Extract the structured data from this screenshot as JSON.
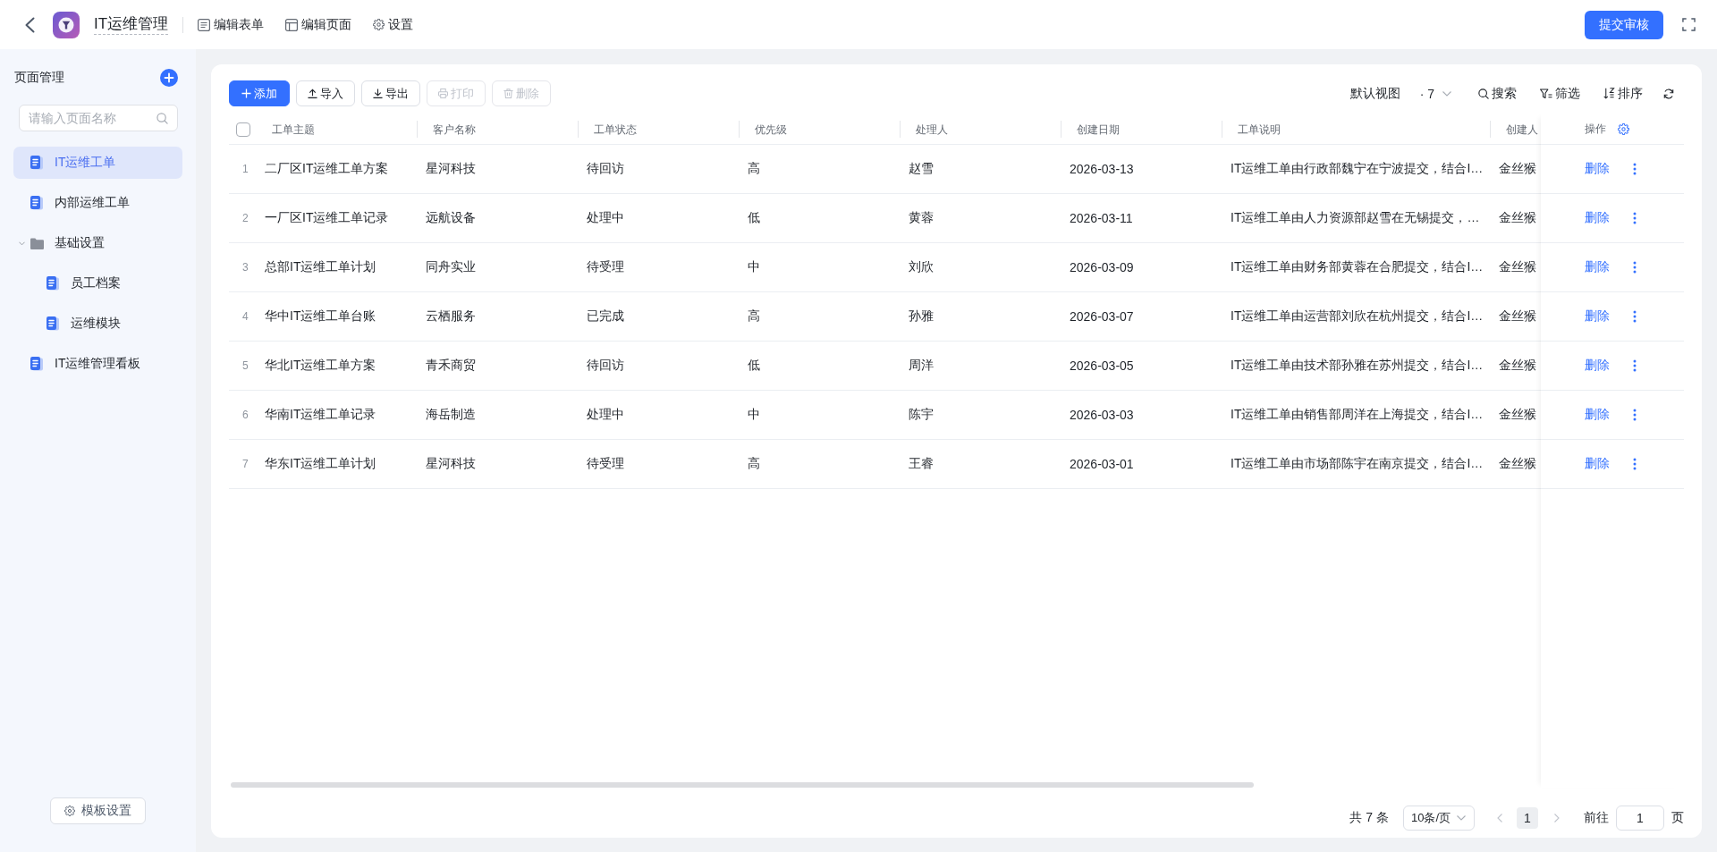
{
  "top_bar": {
    "title": "IT运维管理",
    "nav": [
      {
        "label": "编辑表单",
        "kind": "form"
      },
      {
        "label": "编辑页面",
        "kind": "layout"
      },
      {
        "label": "设置",
        "kind": "settings"
      }
    ],
    "submit_button": "提交审核"
  },
  "sidebar": {
    "title": "页面管理",
    "search": {
      "placeholder": "请输入页面名称"
    },
    "items": [
      {
        "label": "IT运维工单",
        "kind": "page",
        "selected": true
      },
      {
        "label": "内部运维工单",
        "kind": "page",
        "selected": false
      },
      {
        "label": "基础设置",
        "kind": "folder",
        "selected": false,
        "expanded": true,
        "children": [
          {
            "label": "员工档案",
            "kind": "page",
            "selected": false
          },
          {
            "label": "运维模块",
            "kind": "page",
            "selected": false
          }
        ]
      },
      {
        "label": "IT运维管理看板",
        "kind": "page",
        "selected": false
      }
    ],
    "footer_button": "模板设置"
  },
  "toolbar": {
    "buttons": [
      {
        "label": "添加",
        "kind": "add",
        "primary": true,
        "disabled": false
      },
      {
        "label": "导入",
        "kind": "import",
        "primary": false,
        "disabled": false
      },
      {
        "label": "导出",
        "kind": "export",
        "primary": false,
        "disabled": false
      },
      {
        "label": "打印",
        "kind": "print",
        "primary": false,
        "disabled": true
      },
      {
        "label": "删除",
        "kind": "delete",
        "primary": false,
        "disabled": true
      }
    ],
    "view": "默认视图",
    "view_count": "· 7",
    "tools": [
      {
        "label": "搜索",
        "kind": "search"
      },
      {
        "label": "筛选",
        "kind": "filter"
      },
      {
        "label": "排序",
        "kind": "sort"
      }
    ]
  },
  "table": {
    "select_all": {
      "checked": false
    },
    "columns": [
      "工单主题",
      "客户名称",
      "工单状态",
      "优先级",
      "处理人",
      "创建日期",
      "工单说明",
      "创建人"
    ],
    "action_column": "操作",
    "rows": [
      {
        "number": "1",
        "cells": [
          "二厂区IT运维工单方案",
          "星河科技",
          "待回访",
          "高",
          "赵雪",
          "2026-03-13",
          "IT运维工单由行政部魏宁在宁波提交，结合I…",
          "金丝猴"
        ],
        "action": "删除"
      },
      {
        "number": "2",
        "cells": [
          "一厂区IT运维工单记录",
          "远航设备",
          "处理中",
          "低",
          "黄蓉",
          "2026-03-11",
          "IT运维工单由人力资源部赵雪在无锡提交，…",
          "金丝猴"
        ],
        "action": "删除"
      },
      {
        "number": "3",
        "cells": [
          "总部IT运维工单计划",
          "同舟实业",
          "待受理",
          "中",
          "刘欣",
          "2026-03-09",
          "IT运维工单由财务部黄蓉在合肥提交，结合I…",
          "金丝猴"
        ],
        "action": "删除"
      },
      {
        "number": "4",
        "cells": [
          "华中IT运维工单台账",
          "云栖服务",
          "已完成",
          "高",
          "孙雅",
          "2026-03-07",
          "IT运维工单由运营部刘欣在杭州提交，结合I…",
          "金丝猴"
        ],
        "action": "删除"
      },
      {
        "number": "5",
        "cells": [
          "华北IT运维工单方案",
          "青禾商贸",
          "待回访",
          "低",
          "周洋",
          "2026-03-05",
          "IT运维工单由技术部孙雅在苏州提交，结合I…",
          "金丝猴"
        ],
        "action": "删除"
      },
      {
        "number": "6",
        "cells": [
          "华南IT运维工单记录",
          "海岳制造",
          "处理中",
          "中",
          "陈宇",
          "2026-03-03",
          "IT运维工单由销售部周洋在上海提交，结合I…",
          "金丝猴"
        ],
        "action": "删除"
      },
      {
        "number": "7",
        "cells": [
          "华东IT运维工单计划",
          "星河科技",
          "待受理",
          "高",
          "王睿",
          "2026-03-01",
          "IT运维工单由市场部陈宇在南京提交，结合I…",
          "金丝猴"
        ],
        "action": "删除"
      }
    ]
  },
  "pagination": {
    "total": "共 7 条",
    "page_size": "10条/页",
    "pages": [
      {
        "label": "1",
        "selected": true
      }
    ],
    "goto_label": "前往",
    "goto_value": "1",
    "goto_suffix": "页"
  }
}
